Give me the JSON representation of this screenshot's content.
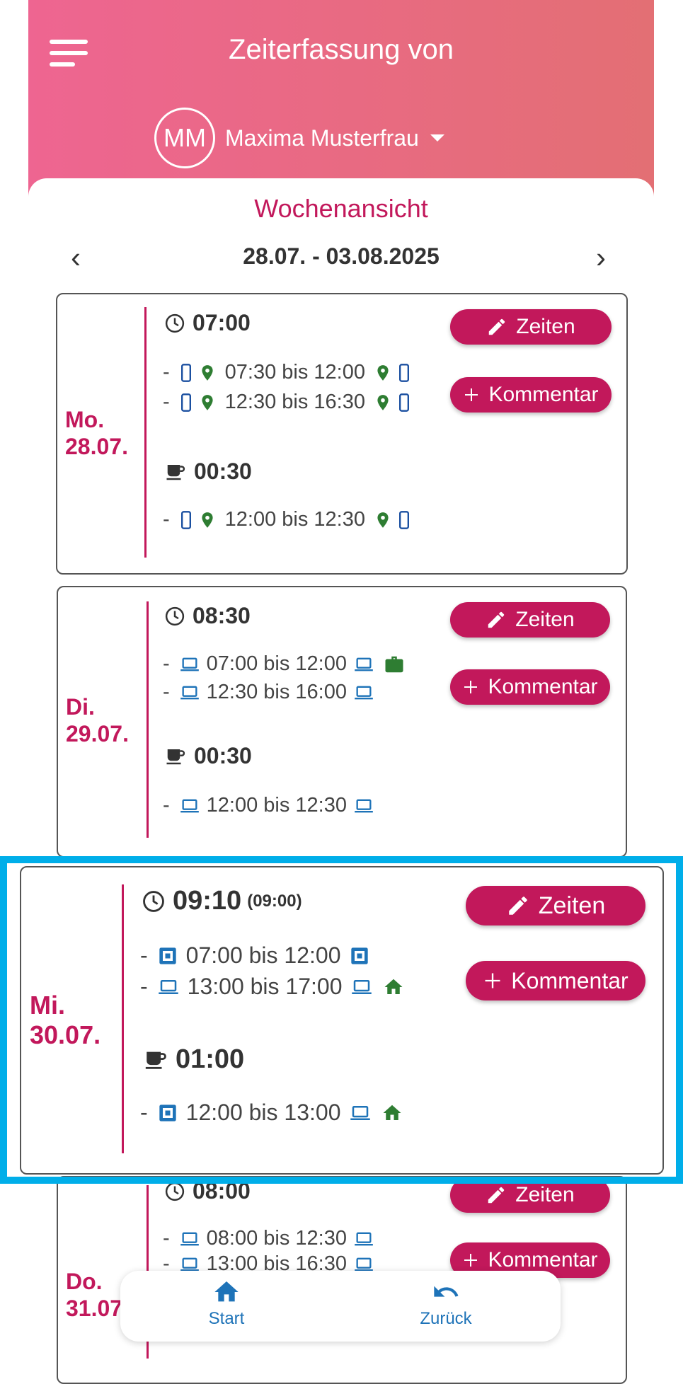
{
  "header": {
    "title": "Zeiterfassung von",
    "user": {
      "initials": "MM",
      "name": "Maxima Musterfrau"
    },
    "gradient": [
      "#ee6591",
      "#e36f74"
    ]
  },
  "week": {
    "view_title": "Wochenansicht",
    "date_range": "28.07. - 03.08.2025",
    "prev": "‹",
    "next": "›"
  },
  "buttons": {
    "zeiten": "Zeiten",
    "kommentar": "Kommentar"
  },
  "accent_color": "#c2185b",
  "days": [
    {
      "weekday": "Mo.",
      "date": "28.07.",
      "work_total": "07:00",
      "break_total": "00:30",
      "work_entries": [
        {
          "start_icon": "phone-location-icon",
          "text": "07:30 bis 12:00",
          "end_icon": "location-phone-icon"
        },
        {
          "start_icon": "phone-location-icon",
          "text": "12:30 bis 16:30",
          "end_icon": "location-phone-icon"
        }
      ],
      "break_entries": [
        {
          "start_icon": "phone-location-icon",
          "text": "12:00 bis 12:30",
          "end_icon": "location-phone-icon"
        }
      ]
    },
    {
      "weekday": "Di.",
      "date": "29.07.",
      "work_total": "08:30",
      "break_total": "00:30",
      "work_entries": [
        {
          "start_icon": "laptop-icon",
          "text": "07:00 bis 12:00",
          "end_icon": "laptop-icon",
          "extra_icon": "briefcase-icon"
        },
        {
          "start_icon": "laptop-icon",
          "text": "12:30 bis 16:00",
          "end_icon": "laptop-icon"
        }
      ],
      "break_entries": [
        {
          "start_icon": "laptop-icon",
          "text": "12:00 bis 12:30",
          "end_icon": "laptop-icon"
        }
      ]
    },
    {
      "weekday": "Mi.",
      "date": "30.07.",
      "work_total": "09:10",
      "planned_total": "(09:00)",
      "break_total": "01:00",
      "work_entries": [
        {
          "start_icon": "terminal-icon",
          "text": "07:00 bis 12:00",
          "end_icon": "terminal-icon"
        },
        {
          "start_icon": "laptop-icon",
          "text": "13:00 bis 17:00",
          "end_icon": "laptop-icon",
          "extra_icon": "home-icon"
        }
      ],
      "break_entries": [
        {
          "start_icon": "terminal-icon",
          "text": "12:00 bis 13:00",
          "end_icon": "laptop-icon",
          "extra_icon": "home-icon"
        }
      ]
    },
    {
      "weekday": "Do.",
      "date": "31.07.",
      "work_total": "08:00",
      "work_entries": [
        {
          "start_icon": "laptop-icon",
          "text": "08:00 bis 12:30",
          "end_icon": "laptop-icon"
        },
        {
          "start_icon": "laptop-icon",
          "text": "13:00 bis 16:30",
          "end_icon": "laptop-icon"
        }
      ]
    }
  ],
  "bottom_nav": {
    "start": "Start",
    "back": "Zurück"
  }
}
